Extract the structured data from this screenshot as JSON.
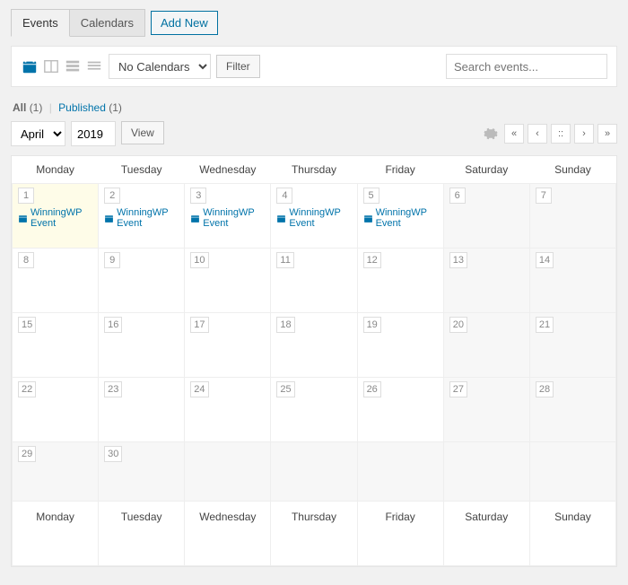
{
  "tabs": {
    "events": "Events",
    "calendars": "Calendars",
    "addnew": "Add New"
  },
  "toolbar": {
    "cal_select": "No Calendars",
    "filter_btn": "Filter",
    "search_placeholder": "Search events..."
  },
  "status": {
    "all_label": "All",
    "all_count": "(1)",
    "published_label": "Published",
    "published_count": "(1)"
  },
  "filters": {
    "month": "April",
    "year": "2019",
    "view_btn": "View"
  },
  "days": [
    "Monday",
    "Tuesday",
    "Wednesday",
    "Thursday",
    "Friday",
    "Saturday",
    "Sunday"
  ],
  "weeks": [
    [
      {
        "n": "1",
        "today": true,
        "event": "WinningWP Event"
      },
      {
        "n": "2",
        "event": "WinningWP Event"
      },
      {
        "n": "3",
        "event": "WinningWP Event"
      },
      {
        "n": "4",
        "event": "WinningWP Event"
      },
      {
        "n": "5",
        "event": "WinningWP Event"
      },
      {
        "n": "6",
        "weekend": true
      },
      {
        "n": "7",
        "weekend": true
      }
    ],
    [
      {
        "n": "8"
      },
      {
        "n": "9"
      },
      {
        "n": "10"
      },
      {
        "n": "11"
      },
      {
        "n": "12"
      },
      {
        "n": "13",
        "weekend": true
      },
      {
        "n": "14",
        "weekend": true
      }
    ],
    [
      {
        "n": "15"
      },
      {
        "n": "16"
      },
      {
        "n": "17"
      },
      {
        "n": "18"
      },
      {
        "n": "19"
      },
      {
        "n": "20",
        "weekend": true
      },
      {
        "n": "21",
        "weekend": true
      }
    ],
    [
      {
        "n": "22"
      },
      {
        "n": "23"
      },
      {
        "n": "24"
      },
      {
        "n": "25"
      },
      {
        "n": "26"
      },
      {
        "n": "27",
        "weekend": true
      },
      {
        "n": "28",
        "weekend": true
      }
    ],
    [
      {
        "n": "29"
      },
      {
        "n": "30"
      },
      {
        "n": ""
      },
      {
        "n": ""
      },
      {
        "n": ""
      },
      {
        "n": ""
      },
      {
        "n": ""
      }
    ]
  ]
}
